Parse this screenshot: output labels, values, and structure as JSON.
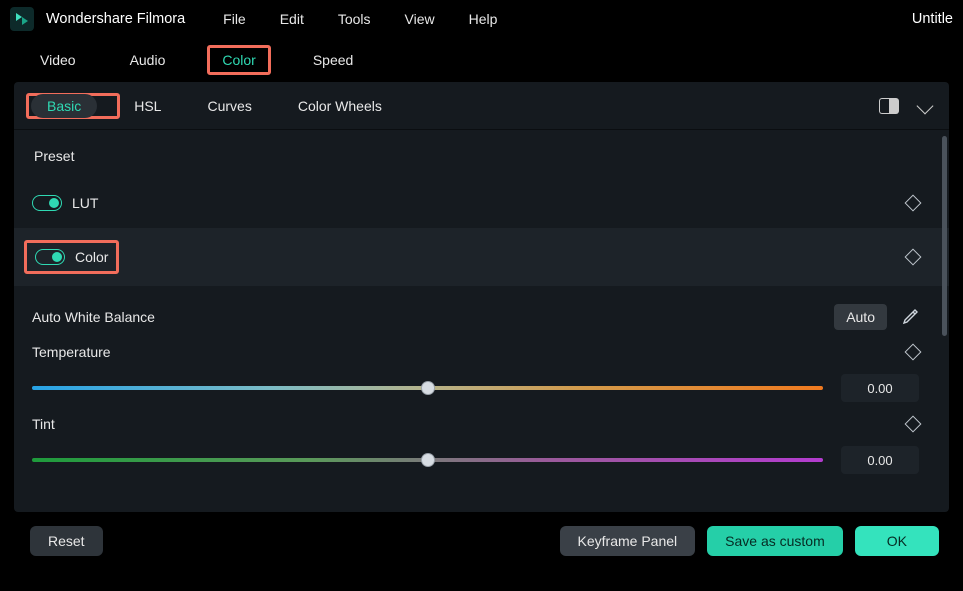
{
  "titlebar": {
    "app_name": "Wondershare Filmora",
    "menu": {
      "file": "File",
      "edit": "Edit",
      "tools": "Tools",
      "view": "View",
      "help": "Help"
    },
    "doc_title": "Untitle"
  },
  "top_tabs": {
    "video": "Video",
    "audio": "Audio",
    "color": "Color",
    "speed": "Speed",
    "active": "color"
  },
  "sub_tabs": {
    "basic": "Basic",
    "hsl": "HSL",
    "curves": "Curves",
    "wheels": "Color Wheels",
    "active": "basic"
  },
  "panel": {
    "preset_label": "Preset",
    "lut_label": "LUT",
    "color_label": "Color",
    "awb_label": "Auto White Balance",
    "auto_btn": "Auto",
    "temperature": {
      "label": "Temperature",
      "value": "0.00",
      "pos_pct": 50
    },
    "tint": {
      "label": "Tint",
      "value": "0.00",
      "pos_pct": 50
    }
  },
  "footer": {
    "reset": "Reset",
    "keyframe": "Keyframe Panel",
    "save_custom": "Save as custom",
    "ok": "OK"
  },
  "colors": {
    "accent": "#2fd9b3",
    "highlight": "#f26d5b"
  }
}
